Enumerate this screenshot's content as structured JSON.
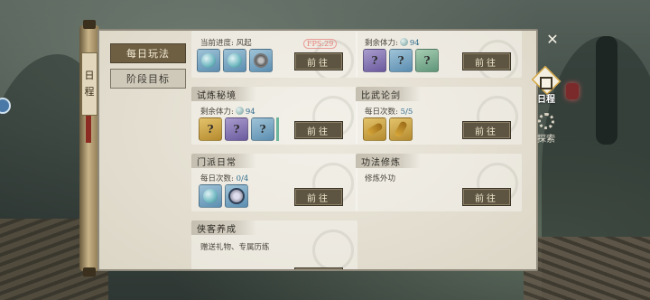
{
  "fps_badge": "FPS:29",
  "scroll": {
    "label_chars": [
      "日",
      "程"
    ]
  },
  "tabs": [
    {
      "label": "每日玩法",
      "active": true
    },
    {
      "label": "阶段目标",
      "active": false
    }
  ],
  "cards": {
    "top_left": {
      "info": "当前进度: 风起",
      "button": "前往",
      "icons": [
        "jade-orb",
        "green-orb",
        "coin"
      ]
    },
    "top_right": {
      "info_prefix": "剩余体力:",
      "info_value": "94",
      "button": "前往",
      "icons": [
        "unknown-reward",
        "unknown-reward",
        "unknown-reward"
      ]
    },
    "trial": {
      "title": "试炼秘境",
      "info_prefix": "剩余体力:",
      "info_value": "94",
      "button": "前往",
      "icons": [
        "unknown-reward",
        "unknown-reward",
        "unknown-reward"
      ]
    },
    "duel": {
      "title": "比武论剑",
      "info_prefix": "每日次数:",
      "info_value": "5/5",
      "button": "前往",
      "icons": [
        "gold-blade",
        "gold-sword"
      ]
    },
    "sect": {
      "title": "门派日常",
      "info_prefix": "每日次数:",
      "info_value": "0/4",
      "button": "前往",
      "icons": [
        "jade-orb",
        "rune-coin"
      ]
    },
    "skill": {
      "title": "功法修炼",
      "info": "修炼外功",
      "button": "前往"
    },
    "hero": {
      "title": "侠客养成",
      "info": "赠送礼物、专属历练"
    }
  },
  "side_tabs": [
    {
      "label": "日程",
      "active": true
    },
    {
      "label": "探索",
      "active": false
    }
  ],
  "close_glyph": "✕"
}
